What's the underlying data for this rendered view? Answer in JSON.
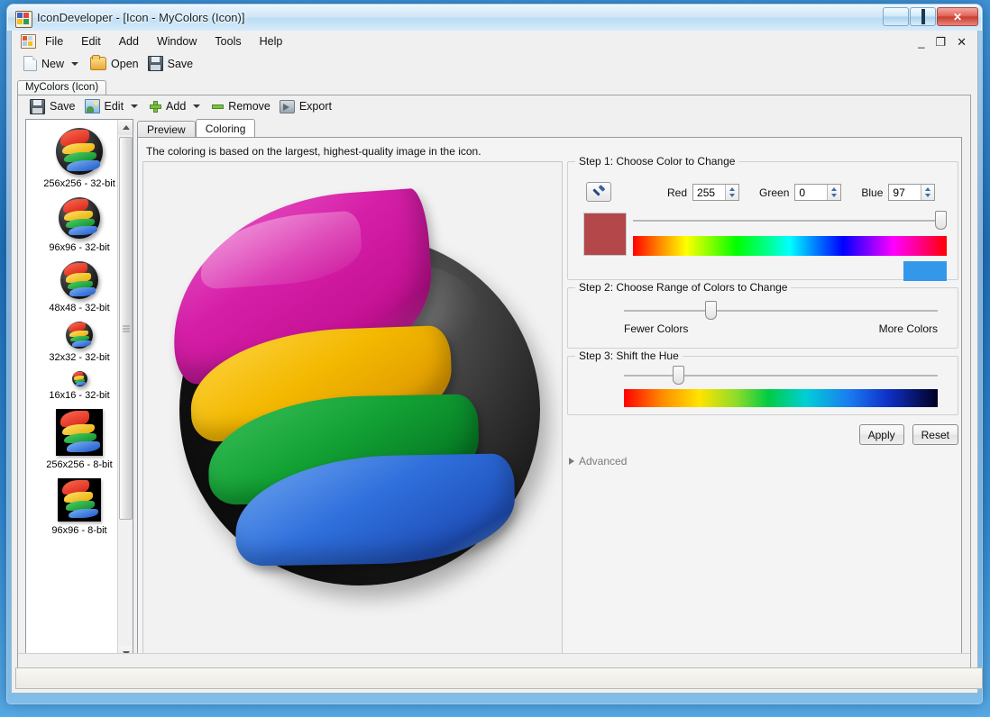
{
  "window": {
    "title": "IconDeveloper - [Icon - MyColors (Icon)]",
    "app_icon": "app-tiles-icon",
    "buttons": {
      "minimize": "minimize-icon",
      "maximize": "maximize-icon",
      "close": "✕"
    }
  },
  "menubar": {
    "icon": "mdi-tiles-icon",
    "items": [
      "File",
      "Edit",
      "Add",
      "Window",
      "Tools",
      "Help"
    ],
    "mdi_buttons": {
      "minimize": "_",
      "restore": "❐",
      "close": "✕"
    }
  },
  "toolbar_main": {
    "items": [
      {
        "label": "New",
        "icon": "new-document-icon",
        "dropdown": true
      },
      {
        "label": "Open",
        "icon": "open-folder-icon",
        "dropdown": false
      },
      {
        "label": "Save",
        "icon": "floppy-save-icon",
        "dropdown": false
      }
    ]
  },
  "document_tab": {
    "label": "MyColors (Icon)"
  },
  "toolbar_doc": {
    "items": [
      {
        "label": "Save",
        "icon": "floppy-save-icon",
        "dropdown": false
      },
      {
        "label": "Edit",
        "icon": "edit-image-icon",
        "dropdown": true
      },
      {
        "label": "Add",
        "icon": "green-plus-icon",
        "dropdown": true
      },
      {
        "label": "Remove",
        "icon": "green-minus-icon",
        "dropdown": false
      },
      {
        "label": "Export",
        "icon": "export-arrow-icon",
        "dropdown": false
      }
    ]
  },
  "icon_list": {
    "entries": [
      {
        "label": "256x256 - 32-bit",
        "size": 52,
        "shape": "sphere"
      },
      {
        "label": "96x96 - 32-bit",
        "size": 46,
        "shape": "sphere"
      },
      {
        "label": "48x48 - 32-bit",
        "size": 42,
        "shape": "sphere"
      },
      {
        "label": "32x32 - 32-bit",
        "size": 30,
        "shape": "sphere"
      },
      {
        "label": "16x16 - 32-bit",
        "size": 17,
        "shape": "sphere"
      },
      {
        "label": "256x256 - 8-bit",
        "size": 52,
        "shape": "square"
      },
      {
        "label": "96x96 - 8-bit",
        "size": 48,
        "shape": "square"
      }
    ],
    "scrollbar": {
      "up": "scroll-up-arrow",
      "down": "scroll-down-arrow"
    }
  },
  "tabs": [
    {
      "label": "Preview",
      "active": false
    },
    {
      "label": "Coloring",
      "active": true
    }
  ],
  "panel": {
    "note": "The coloring is based on the largest, highest-quality image in the icon."
  },
  "step1": {
    "title": "Step 1: Choose Color to Change",
    "pipette_icon": "eyedropper-icon",
    "red_label": "Red",
    "red_value": "255",
    "green_label": "Green",
    "green_value": "0",
    "blue_label": "Blue",
    "blue_value": "97",
    "swatch_color": "#b3474a",
    "selection_color": "#3498ea",
    "slider_position_pct": 100
  },
  "step2": {
    "title": "Step 2: Choose Range of Colors to Change",
    "left_label": "Fewer Colors",
    "right_label": "More Colors",
    "slider_position_pct": 27
  },
  "step3": {
    "title": "Step 3: Shift the Hue",
    "slider_position_pct": 16
  },
  "actions": {
    "apply_label": "Apply",
    "reset_label": "Reset",
    "advanced_label": "Advanced",
    "advanced_icon": "triangle-right-icon"
  },
  "statusbar": {
    "text": ""
  }
}
